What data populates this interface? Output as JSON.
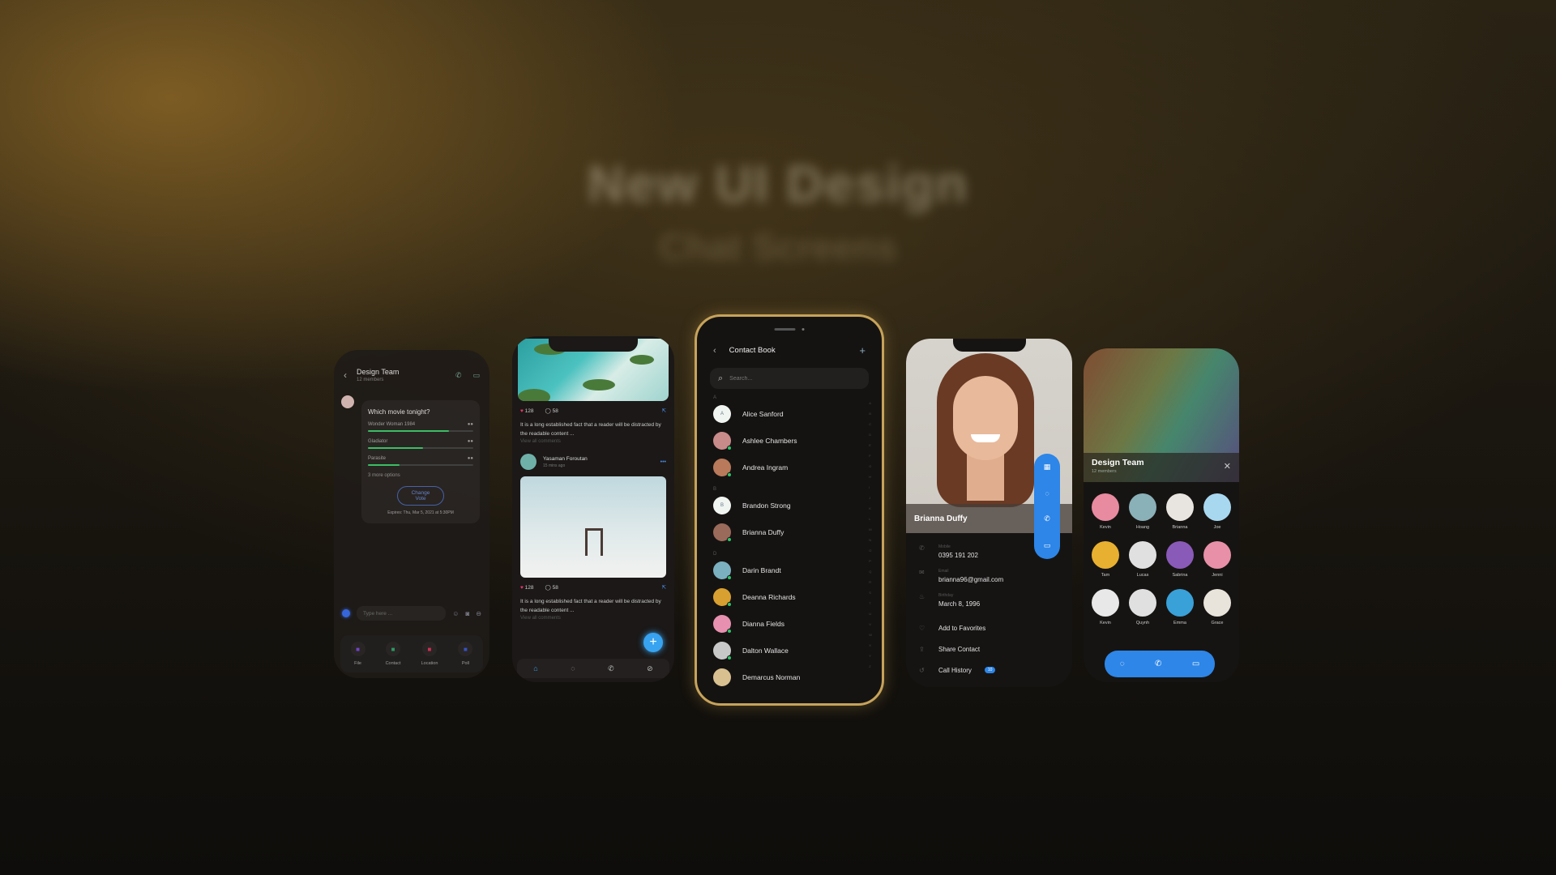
{
  "hero": {
    "title": "New UI Design",
    "subtitle": "Chat Screens"
  },
  "chat": {
    "header": {
      "title": "Design Team",
      "subtitle": "12 members"
    },
    "poll": {
      "question": "Which movie tonight?",
      "options": [
        {
          "label": "Wonder Woman 1984",
          "votes_fraction": 0.77
        },
        {
          "label": "Gladiator",
          "votes_fraction": 0.52
        },
        {
          "label": "Parasite",
          "votes_fraction": 0.3
        }
      ],
      "more": "3 more options",
      "change_vote": "Change Vote",
      "expires": "Expires: Thu, Mar 5, 2021 at 5:30PM"
    },
    "composer_placeholder": "Type here ...",
    "attachments": [
      {
        "label": "File",
        "color": "#7a4ad8"
      },
      {
        "label": "Contact",
        "color": "#2fa86a"
      },
      {
        "label": "Location",
        "color": "#e0345a"
      },
      {
        "label": "Poll",
        "color": "#3a5ad8"
      }
    ]
  },
  "feed": {
    "posts": [
      {
        "likes": "128",
        "comments": "58",
        "text": "It is a long established fact that a reader will be distracted by the readable content ...",
        "view_comments": "View all comments"
      },
      {
        "likes": "128",
        "comments": "58",
        "text": "It is a long established fact that a reader will be distracted by the readable content ...",
        "view_comments": "View all comments"
      }
    ],
    "author": {
      "name": "Yasaman Foroutan",
      "time": "15 mins ago"
    }
  },
  "contacts": {
    "title": "Contact Book",
    "search_placeholder": "Search...",
    "sections": [
      {
        "letter": "A",
        "items": [
          {
            "name": "Alice Sanford",
            "initial": "A",
            "online": false,
            "color": ""
          },
          {
            "name": "Ashlee Chambers",
            "initial": "",
            "online": true,
            "color": "#c98a8a"
          },
          {
            "name": "Andrea Ingram",
            "initial": "",
            "online": true,
            "color": "#b87a5a"
          }
        ]
      },
      {
        "letter": "B",
        "items": [
          {
            "name": "Brandon Strong",
            "initial": "B",
            "online": false,
            "color": ""
          },
          {
            "name": "Brianna Duffy",
            "initial": "",
            "online": true,
            "color": "#9a6a5a"
          }
        ]
      },
      {
        "letter": "D",
        "items": [
          {
            "name": "Darin Brandt",
            "initial": "",
            "online": true,
            "color": "#7ab0c0"
          },
          {
            "name": "Deanna Richards",
            "initial": "",
            "online": true,
            "color": "#d8a030"
          },
          {
            "name": "Dianna Fields",
            "initial": "",
            "online": true,
            "color": "#e890b0"
          },
          {
            "name": "Dalton Wallace",
            "initial": "",
            "online": true,
            "color": "#c8c8c8"
          },
          {
            "name": "Demarcus Norman",
            "initial": "",
            "online": false,
            "color": "#d8c090"
          }
        ]
      }
    ],
    "alphabet": [
      "A",
      "B",
      "C",
      "D",
      "E",
      "F",
      "G",
      "H",
      "I",
      "J",
      "K",
      "L",
      "M",
      "N",
      "O",
      "P",
      "Q",
      "R",
      "S",
      "T",
      "U",
      "V",
      "W",
      "X",
      "Y",
      "Z"
    ]
  },
  "profile": {
    "name": "Brianna Duffy",
    "fields": [
      {
        "label": "Mobile",
        "value": "0395 191 202",
        "icon": "phone-icon"
      },
      {
        "label": "Email",
        "value": "brianna96@gmail.com",
        "icon": "mail-icon"
      },
      {
        "label": "Birthday",
        "value": "March 8, 1996",
        "icon": "cake-icon"
      }
    ],
    "actions": [
      {
        "label": "Add to Favorites",
        "badge": ""
      },
      {
        "label": "Share Contact",
        "badge": ""
      },
      {
        "label": "Call History",
        "badge": "10"
      }
    ]
  },
  "team": {
    "title": "Design Team",
    "subtitle": "12 members",
    "members": [
      {
        "name": "Kevin",
        "color": "#e88aa0"
      },
      {
        "name": "Hoang",
        "color": "#8ab0b8"
      },
      {
        "name": "Brianna",
        "color": "#e8e4e0"
      },
      {
        "name": "Joe",
        "color": "#a8d8f0"
      },
      {
        "name": "Tam",
        "color": "#e8b030"
      },
      {
        "name": "Lucas",
        "color": "#e0e0e0"
      },
      {
        "name": "Sabrina",
        "color": "#8a5ab8"
      },
      {
        "name": "Jenni",
        "color": "#e890a8"
      },
      {
        "name": "Kevin",
        "color": "#e8e8e8"
      },
      {
        "name": "Quynh",
        "color": "#e0e0e0"
      },
      {
        "name": "Emma",
        "color": "#3aa0d8"
      },
      {
        "name": "Grace",
        "color": "#e8e4dc"
      }
    ]
  },
  "accent": "#2d86e8"
}
